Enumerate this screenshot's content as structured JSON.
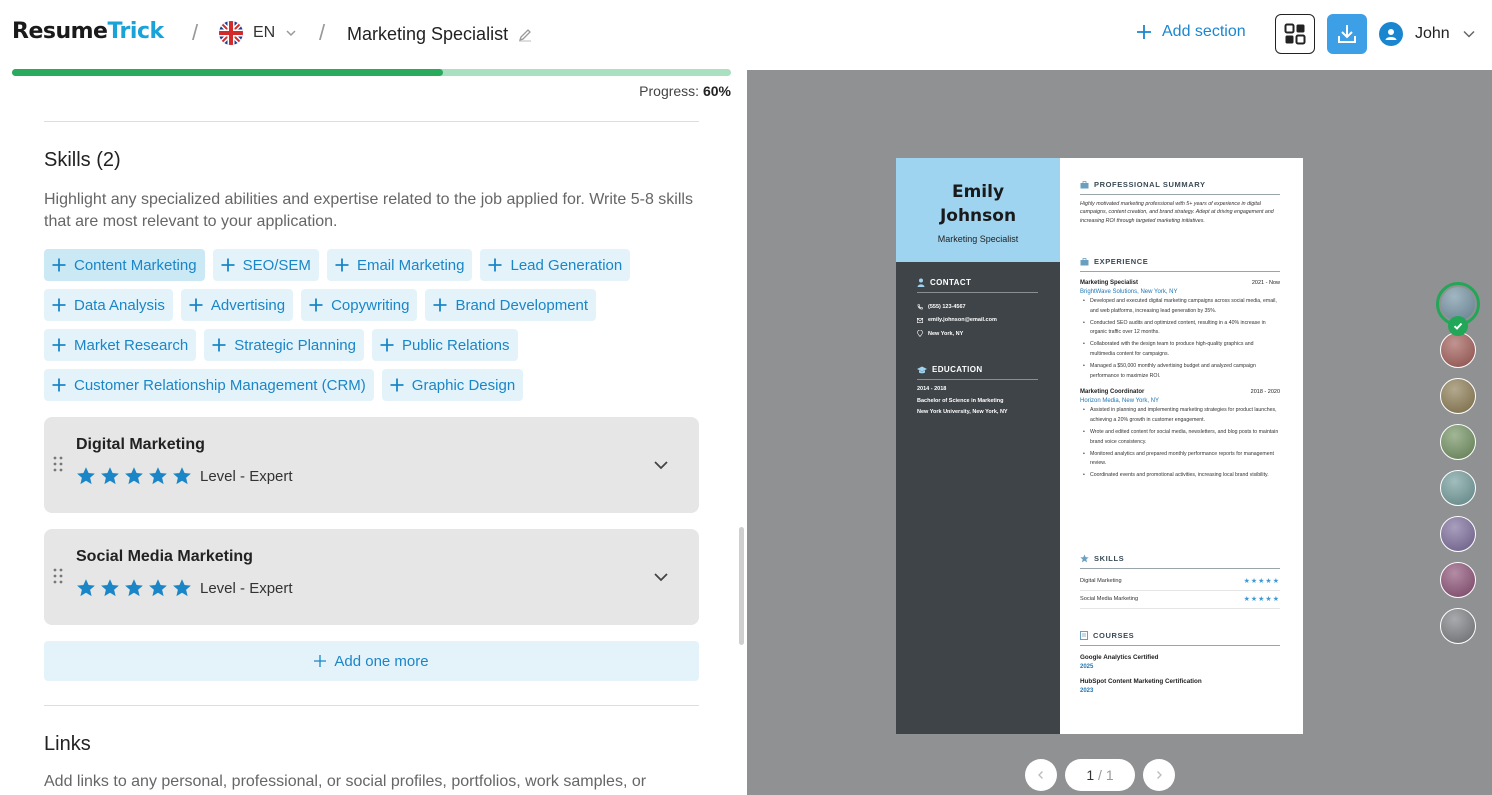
{
  "header": {
    "logo_main": "Resume",
    "logo_accent": "Trick",
    "language": "EN",
    "document_title": "Marketing Specialist",
    "add_section_label": "Add section",
    "user_name": "John"
  },
  "progress": {
    "label": "Progress:",
    "value_text": "60%",
    "value": 0.6
  },
  "skills": {
    "title": "Skills (2)",
    "description": "Highlight any specialized abilities and expertise related to the job applied for. Write 5-8 skills that are most relevant to your application.",
    "suggestions": [
      "Content Marketing",
      "SEO/SEM",
      "Email Marketing",
      "Lead Generation",
      "Data Analysis",
      "Advertising",
      "Copywriting",
      "Brand Development",
      "Market Research",
      "Strategic Planning",
      "Public Relations",
      "Customer Relationship Management (CRM)",
      "Graphic Design"
    ],
    "items": [
      {
        "name": "Digital Marketing",
        "rating": 5,
        "level_text": "Level - Expert"
      },
      {
        "name": "Social Media Marketing",
        "rating": 5,
        "level_text": "Level - Expert"
      }
    ],
    "add_more_label": "Add one more"
  },
  "links": {
    "title": "Links",
    "description": "Add links to any personal, professional, or social profiles, portfolios, work samples, or"
  },
  "resume_preview": {
    "first_name": "Emily",
    "last_name": "Johnson",
    "role": "Marketing Specialist",
    "contact_heading": "CONTACT",
    "phone": "(555) 123-4567",
    "email": "emily.johnson@email.com",
    "location": "New York, NY",
    "education_heading": "EDUCATION",
    "education": {
      "years": "2014 - 2018",
      "degree": "Bachelor of Science in Marketing",
      "school": "New York University, New York, NY"
    },
    "summary_heading": "PROFESSIONAL SUMMARY",
    "summary": "Highly motivated marketing professional with 5+ years of experience in digital campaigns, content creation, and brand strategy. Adept at driving engagement and increasing ROI through targeted marketing initiatives.",
    "experience_heading": "EXPERIENCE",
    "jobs": [
      {
        "title": "Marketing Specialist",
        "dates": "2021 - Now",
        "company": "BrightWave Solutions, New York, NY",
        "bullets": [
          "Developed and executed digital marketing campaigns across social media, email, and web platforms, increasing lead generation by 35%.",
          "Conducted SEO audits and optimized content, resulting in a 40% increase in organic traffic over 12 months.",
          "Collaborated with the design team to produce high-quality graphics and multimedia content for campaigns.",
          "Managed a $50,000 monthly advertising budget and analyzed campaign performance to maximize ROI."
        ]
      },
      {
        "title": "Marketing Coordinator",
        "dates": "2018 - 2020",
        "company": "Horizon Media, New York, NY",
        "bullets": [
          "Assisted in planning and implementing marketing strategies for product launches, achieving a 20% growth in customer engagement.",
          "Wrote and edited content for social media, newsletters, and blog posts to maintain brand voice consistency.",
          "Monitored analytics and prepared monthly performance reports for management review.",
          "Coordinated events and promotional activities, increasing local brand visibility."
        ]
      }
    ],
    "skills_heading": "SKILLS",
    "skills": [
      {
        "name": "Digital Marketing",
        "stars": "★★★★★"
      },
      {
        "name": "Social Media Marketing",
        "stars": "★★★★★"
      }
    ],
    "courses_heading": "COURSES",
    "courses": [
      {
        "name": "Google Analytics Certified",
        "year": "2025"
      },
      {
        "name": "HubSpot Content Marketing Certification",
        "year": "2023"
      }
    ]
  },
  "pager": {
    "current": "1",
    "total": "/ 1"
  },
  "color_swatches": [
    "#6f8fa0",
    "#a05a55",
    "#8a7a50",
    "#6f8f5e",
    "#6f9999",
    "#7a6a9a",
    "#8a4e74",
    "#7a7c80"
  ],
  "colors": {
    "accent": "#1a86c8",
    "progress": "#2aaa5c",
    "preview_bg": "#909193"
  }
}
